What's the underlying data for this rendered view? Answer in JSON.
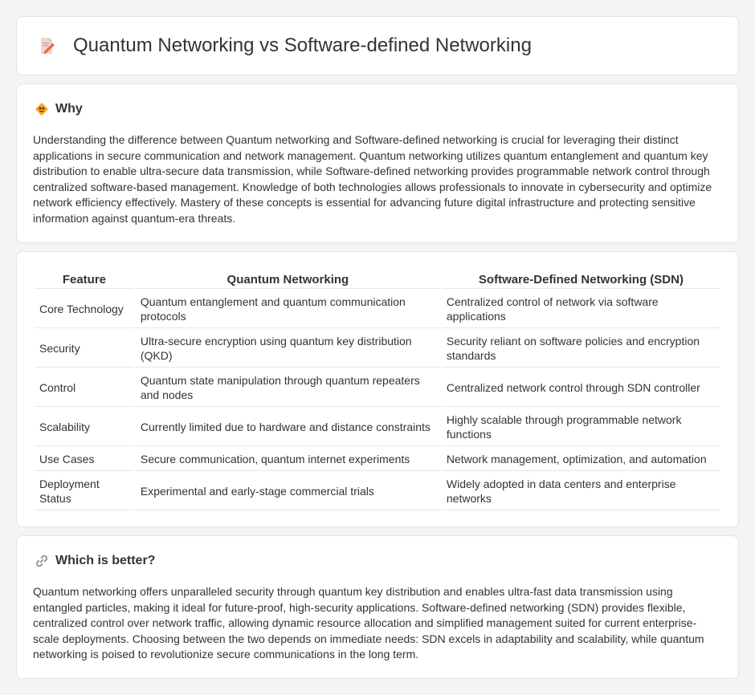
{
  "header": {
    "title": "Quantum Networking vs Software-defined Networking",
    "icon": "document-pencil-icon"
  },
  "why": {
    "heading": "Why",
    "icon": "lightbulb-icon",
    "text": "Understanding the difference between Quantum networking and Software-defined networking is crucial for leveraging their distinct applications in secure communication and network management. Quantum networking utilizes quantum entanglement and quantum key distribution to enable ultra-secure data transmission, while Software-defined networking provides programmable network control through centralized software-based management. Knowledge of both technologies allows professionals to innovate in cybersecurity and optimize network efficiency effectively. Mastery of these concepts is essential for advancing future digital infrastructure and protecting sensitive information against quantum-era threats."
  },
  "table": {
    "headers": [
      "Feature",
      "Quantum Networking",
      "Software-Defined Networking (SDN)"
    ],
    "rows": [
      [
        "Core Technology",
        "Quantum entanglement and quantum communication protocols",
        "Centralized control of network via software applications"
      ],
      [
        "Security",
        "Ultra-secure encryption using quantum key distribution (QKD)",
        "Security reliant on software policies and encryption standards"
      ],
      [
        "Control",
        "Quantum state manipulation through quantum repeaters and nodes",
        "Centralized network control through SDN controller"
      ],
      [
        "Scalability",
        "Currently limited due to hardware and distance constraints",
        "Highly scalable through programmable network functions"
      ],
      [
        "Use Cases",
        "Secure communication, quantum internet experiments",
        "Network management, optimization, and automation"
      ],
      [
        "Deployment Status",
        "Experimental and early-stage commercial trials",
        "Widely adopted in data centers and enterprise networks"
      ]
    ]
  },
  "better": {
    "heading": "Which is better?",
    "icon": "link-icon",
    "text": "Quantum networking offers unparalleled security through quantum key distribution and enables ultra-fast data transmission using entangled particles, making it ideal for future-proof, high-security applications. Software-defined networking (SDN) provides flexible, centralized control over network traffic, allowing dynamic resource allocation and simplified management suited for current enterprise-scale deployments. Choosing between the two depends on immediate needs: SDN excels in adaptability and scalability, while quantum networking is poised to revolutionize secure communications in the long term."
  }
}
